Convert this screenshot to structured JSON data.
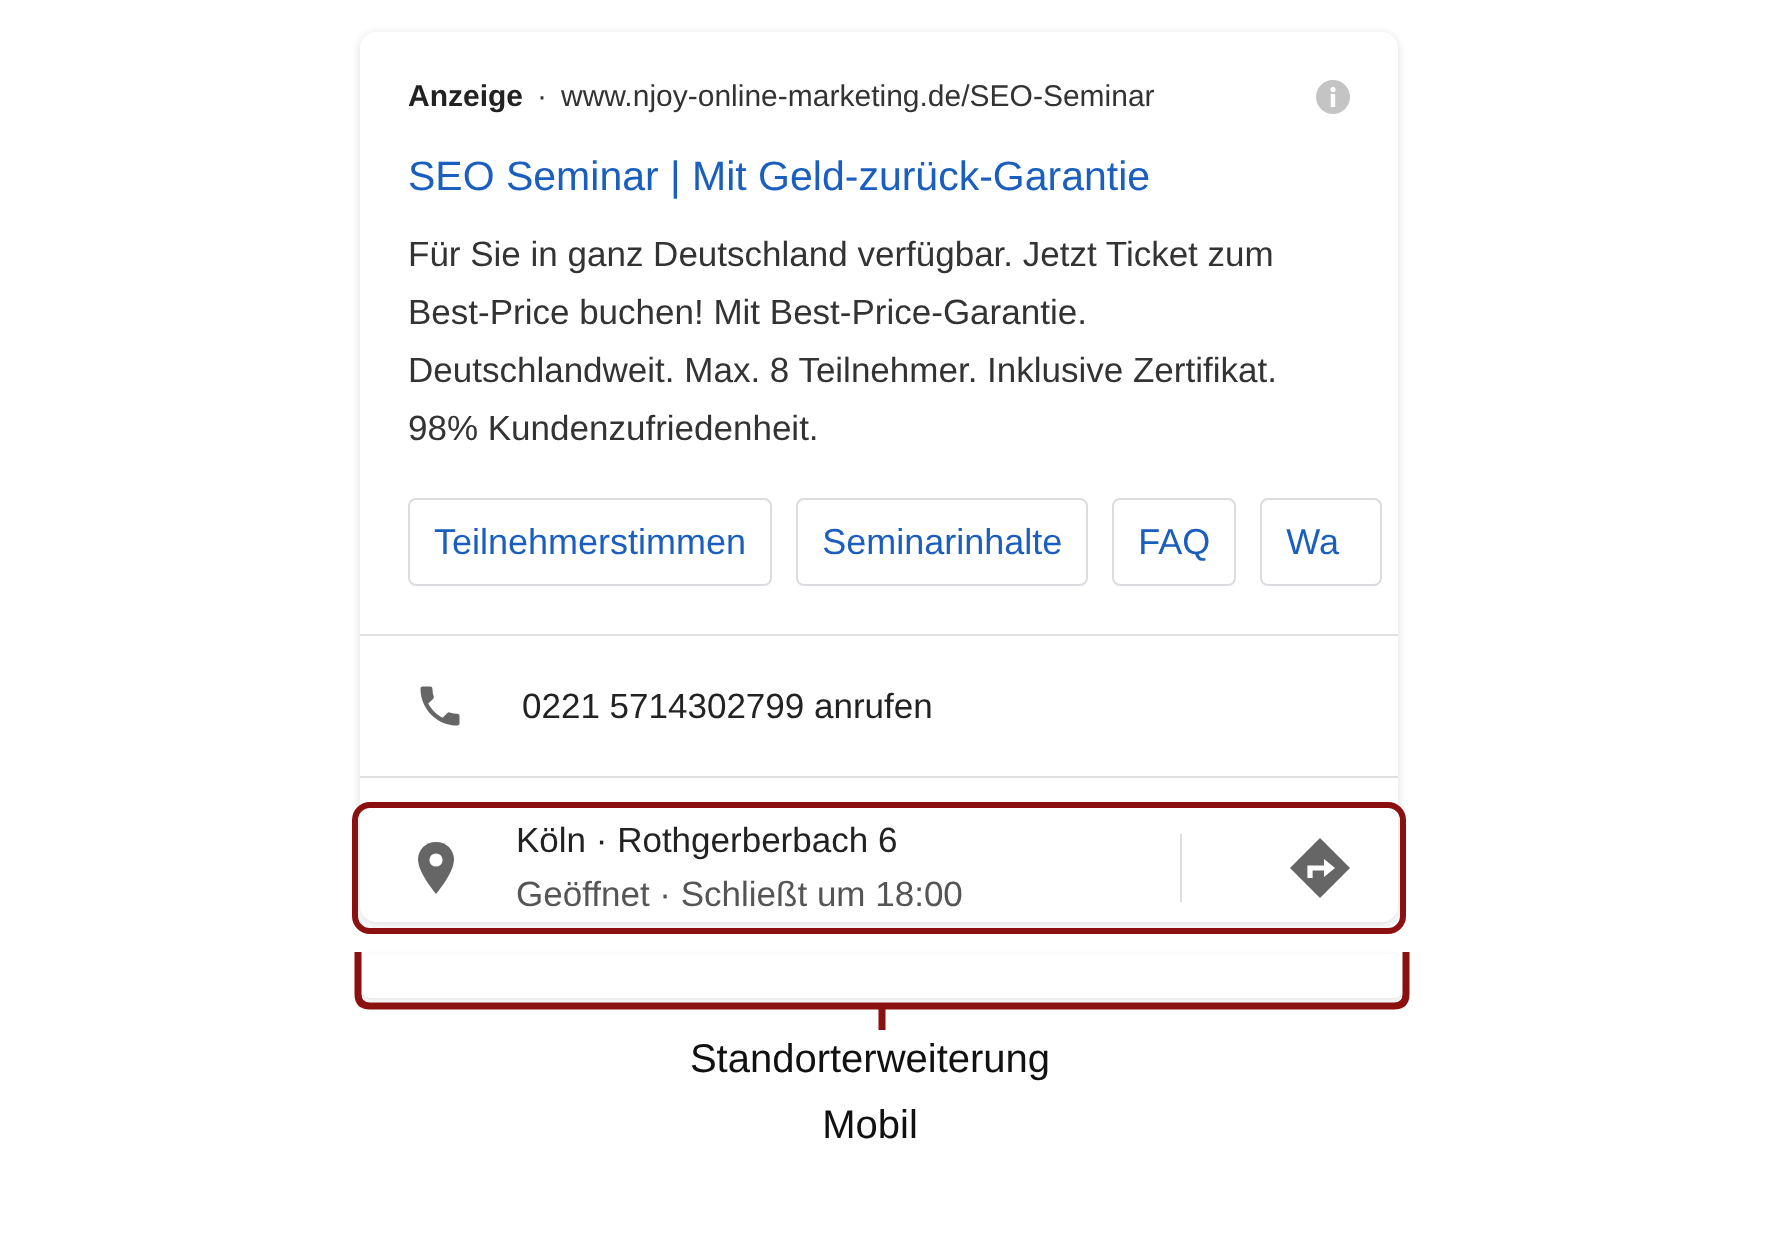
{
  "ad": {
    "label": "Anzeige",
    "separator": "·",
    "url": "www.njoy-online-marketing.de/SEO-Seminar",
    "title": "SEO Seminar | Mit Geld-zurück-Garantie",
    "description": "Für Sie in ganz Deutschland verfügbar. Jetzt Ticket zum Best-Price buchen! Mit Best-Price-Garantie. Deutschlandweit. Max. 8 Teilnehmer. Inklusive Zertifikat. 98% Kundenzufriedenheit.",
    "sitelinks": [
      "Teilnehmerstimmen",
      "Seminarinhalte",
      "FAQ",
      "Wa"
    ]
  },
  "call_extension": {
    "text": "0221 5714302799 anrufen"
  },
  "location_extension": {
    "address": "Köln · Rothgerberbach 6",
    "hours": "Geöffnet · Schließt um 18:00",
    "highlighted": true
  },
  "caption": [
    "Standorterweiterung",
    "Mobil"
  ]
}
